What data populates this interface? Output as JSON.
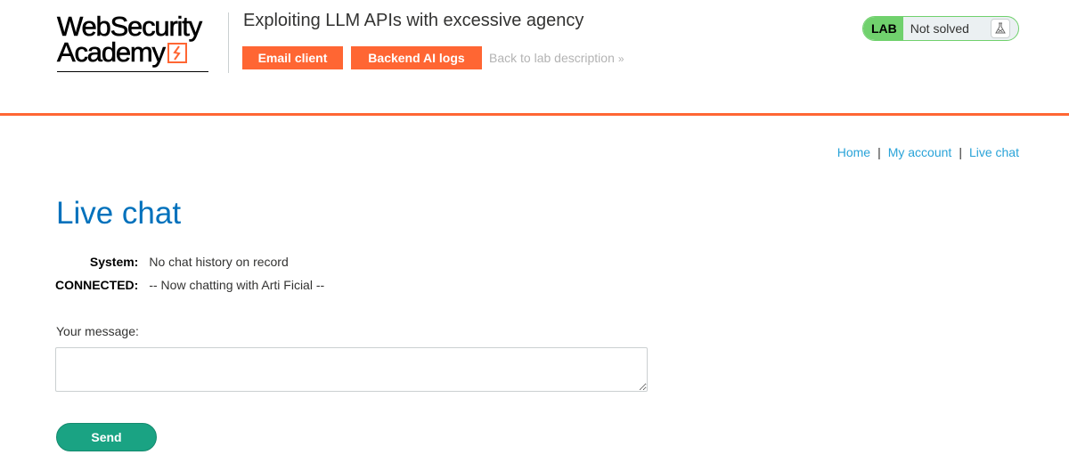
{
  "header": {
    "logo_line1": "WebSecurity",
    "logo_line2": "Academy",
    "lab_title": "Exploiting LLM APIs with excessive agency",
    "buttons": {
      "email_client": "Email client",
      "backend_logs": "Backend AI logs"
    },
    "back_link": "Back to lab description",
    "back_chevron": "»",
    "lab_badge": "LAB",
    "lab_state": "Not solved",
    "colors": {
      "accent": "#ff6633",
      "lab_green": "#70d16d"
    }
  },
  "nav": {
    "home": "Home",
    "my_account": "My account",
    "live_chat": "Live chat",
    "separator": "|"
  },
  "page": {
    "title": "Live chat",
    "chat": [
      {
        "who": "System:",
        "message": "No chat history on record"
      },
      {
        "who": "CONNECTED:",
        "message": "-- Now chatting with Arti Ficial --"
      }
    ],
    "message_label": "Your message:",
    "message_value": "",
    "send_label": "Send"
  }
}
